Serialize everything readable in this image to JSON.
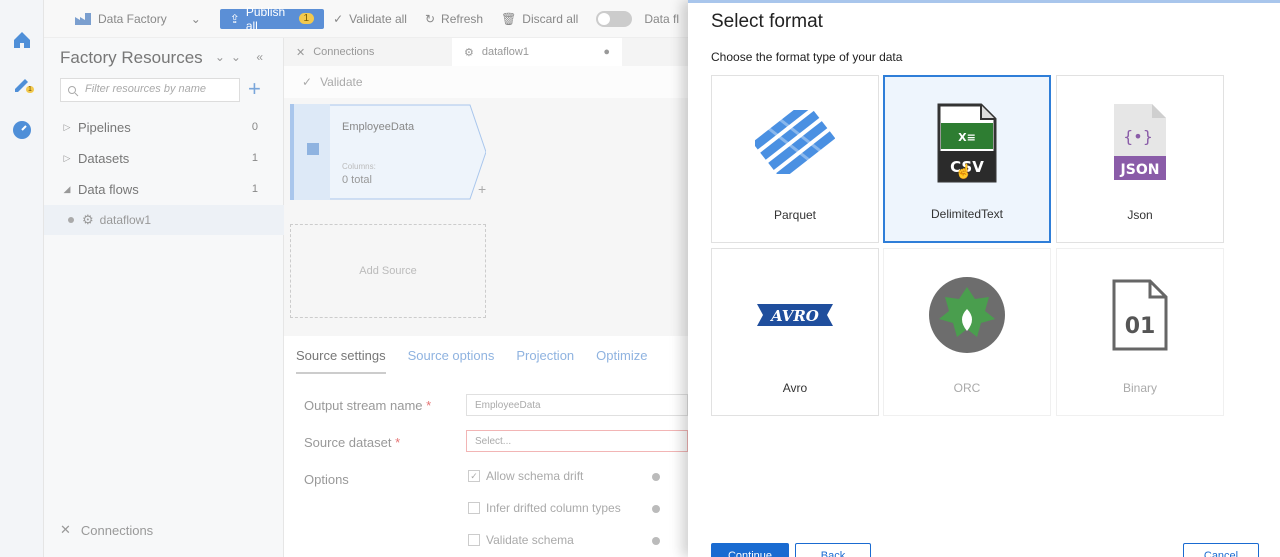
{
  "toolbar": {
    "app_name": "Data Factory",
    "publish_label": "Publish all",
    "publish_count": "1",
    "validate_all": "Validate all",
    "refresh": "Refresh",
    "discard_all": "Discard all",
    "data_flow_debug": "Data fl"
  },
  "rail": {
    "author_badge": "1"
  },
  "resources": {
    "title": "Factory Resources",
    "search_placeholder": "Filter resources by name",
    "items": [
      {
        "label": "Pipelines",
        "count": "0"
      },
      {
        "label": "Datasets",
        "count": "1"
      },
      {
        "label": "Data flows",
        "count": "1"
      }
    ],
    "child": "dataflow1",
    "connections": "Connections"
  },
  "center": {
    "tabs": [
      "Connections",
      "dataflow1"
    ],
    "validate": "Validate",
    "node": {
      "title": "EmployeeData",
      "columns_label": "Columns:",
      "total": "0 total"
    },
    "add_source": "Add Source",
    "settings_tabs": [
      "Source settings",
      "Source options",
      "Projection",
      "Optimize"
    ],
    "fields": {
      "output_stream_label": "Output stream name",
      "output_stream_value": "EmployeeData",
      "source_dataset_label": "Source dataset",
      "source_dataset_value": "Select...",
      "options_label": "Options"
    },
    "options": [
      "Allow schema drift",
      "Infer drifted column types",
      "Validate schema"
    ]
  },
  "panel": {
    "title": "Select format",
    "subtitle": "Choose the format type of your data",
    "formats": [
      {
        "label": "Parquet",
        "icon": "parquet-icon"
      },
      {
        "label": "DelimitedText",
        "icon": "csv-file-icon",
        "icon_text": "CSV",
        "icon_badge": "X≡"
      },
      {
        "label": "Json",
        "icon": "json-file-icon",
        "icon_text": "JSON",
        "icon_braces": "{•}"
      },
      {
        "label": "Avro",
        "icon": "avro-logo-icon",
        "icon_text": "AVRO"
      },
      {
        "label": "ORC",
        "icon": "orc-logo-icon"
      },
      {
        "label": "Binary",
        "icon": "binary-file-icon",
        "icon_text": "01"
      }
    ],
    "selected": "DelimitedText",
    "continue": "Continue",
    "back": "Back",
    "cancel": "Cancel"
  },
  "colors": {
    "accent": "#2f7ed8",
    "primary_button": "#1a6bd1",
    "selected_card_bg": "#eef5fd",
    "parquet_blue": "#4a90e2",
    "csv_green": "#2e7d32",
    "json_purple": "#8a5ca8",
    "orc_green": "#4a9e4e"
  }
}
